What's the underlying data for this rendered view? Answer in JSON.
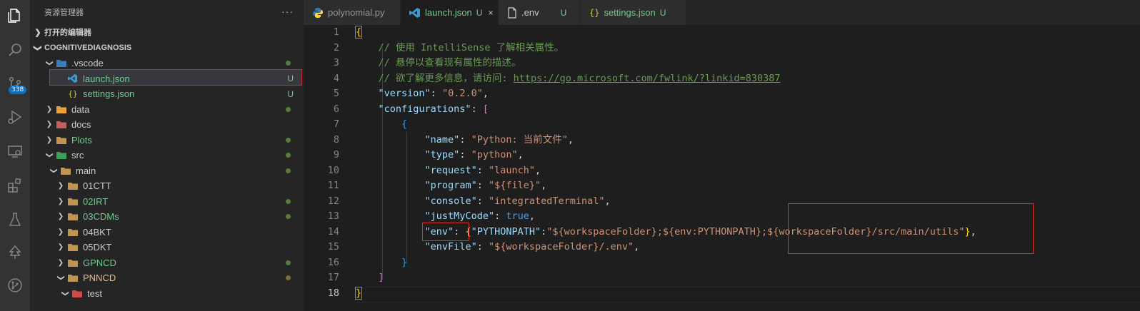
{
  "sidebar": {
    "title": "资源管理器",
    "more": "···",
    "open_editors": "打开的编辑器",
    "project": "COGNITIVEDIAGNOSIS",
    "items": [
      {
        "name": ".vscode",
        "color": "#cccccc",
        "status": "dot",
        "status_color": "#587c3b",
        "expanded": true
      },
      {
        "name": "launch.json",
        "color": "#73c991",
        "status": "U"
      },
      {
        "name": "settings.json",
        "color": "#73c991",
        "status": "U"
      },
      {
        "name": "data",
        "color": "#cccccc",
        "status": "dot",
        "status_color": "#587c3b"
      },
      {
        "name": "docs",
        "color": "#cccccc",
        "status": ""
      },
      {
        "name": "Plots",
        "color": "#73c991",
        "status": "dot",
        "status_color": "#587c3b"
      },
      {
        "name": "src",
        "color": "#cccccc",
        "status": "dot",
        "status_color": "#587c3b",
        "expanded": true
      },
      {
        "name": "main",
        "color": "#cccccc",
        "status": "dot",
        "status_color": "#587c3b",
        "expanded": true
      },
      {
        "name": "01CTT",
        "color": "#cccccc",
        "status": ""
      },
      {
        "name": "02IRT",
        "color": "#73c991",
        "status": "dot",
        "status_color": "#587c3b"
      },
      {
        "name": "03CDMs",
        "color": "#73c991",
        "status": "dot",
        "status_color": "#587c3b"
      },
      {
        "name": "04BKT",
        "color": "#cccccc",
        "status": ""
      },
      {
        "name": "05DKT",
        "color": "#cccccc",
        "status": ""
      },
      {
        "name": "GPNCD",
        "color": "#73c991",
        "status": "dot",
        "status_color": "#587c3b"
      },
      {
        "name": "PNNCD",
        "color": "#e2c08d",
        "status": "dot",
        "status_color": "#7a6a40",
        "expanded": true
      },
      {
        "name": "test",
        "color": "#cccccc",
        "status": "",
        "expanded": true
      }
    ]
  },
  "activity": {
    "scm_badge": "338"
  },
  "tabs": [
    {
      "label": "polynomial.py",
      "icon": "python-icon",
      "status": ""
    },
    {
      "label": "launch.json",
      "icon": "vscode-icon",
      "status": "U",
      "active": true,
      "close": "×"
    },
    {
      "label": ".env",
      "icon": "file-icon",
      "status": "U"
    },
    {
      "label": "settings.json",
      "icon": "braces-icon",
      "status": "U"
    }
  ],
  "editor": {
    "line_numbers": [
      "1",
      "2",
      "3",
      "4",
      "5",
      "6",
      "7",
      "8",
      "9",
      "10",
      "11",
      "12",
      "13",
      "14",
      "15",
      "16",
      "17",
      "18"
    ],
    "comment1": "// 使用 IntelliSense 了解相关属性。",
    "comment2": "// 悬停以查看现有属性的描述。",
    "comment3_prefix": "// 欲了解更多信息，请访问: ",
    "comment3_link": "https://go.microsoft.com/fwlink/?linkid=830387",
    "version_key": "\"version\"",
    "version_val": "\"0.2.0\"",
    "configurations_key": "\"configurations\"",
    "name_key": "\"name\"",
    "name_val": "\"Python: 当前文件\"",
    "type_key": "\"type\"",
    "type_val": "\"python\"",
    "request_key": "\"request\"",
    "request_val": "\"launch\"",
    "program_key": "\"program\"",
    "program_val": "\"${file}\"",
    "console_key": "\"console\"",
    "console_val": "\"integratedTerminal\"",
    "justmycode_key": "\"justMyCode\"",
    "justmycode_val": "true",
    "env_key": "\"env\"",
    "env_inner_key": "\"PYTHONPATH\"",
    "env_val_a": "\"${workspaceFolder};${env:PYTHONPATH}",
    "env_val_b": ";${workspaceFolder}/src/main/utils\"",
    "envfile_key": "\"envFile\"",
    "envfile_val": "\"${workspaceFolder}/.env\""
  }
}
